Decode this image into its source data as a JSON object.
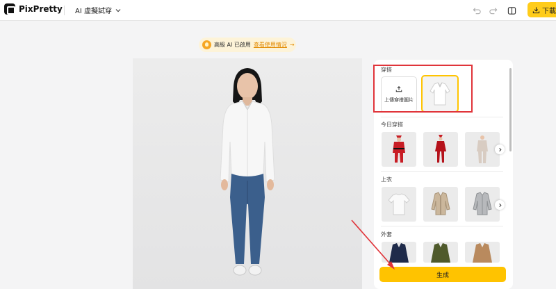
{
  "app": {
    "name": "PixPretty"
  },
  "header": {
    "tool_name": "AI 虛擬試穿",
    "download_label": "下載"
  },
  "credits_banner": {
    "status_text": "高級 AI 已啟用",
    "link_text": "查看使用情況",
    "arrow": "→"
  },
  "panel": {
    "outfit_label": "穿搭",
    "upload_label": "上傳穿搭圖片",
    "sections": [
      {
        "label": "今日穿搭",
        "items": [
          "santa-costume",
          "red-santa-dress",
          "beige-suit"
        ]
      },
      {
        "label": "上衣",
        "items": [
          "white-tshirt",
          "beige-cardigan",
          "grey-shirt"
        ]
      },
      {
        "label": "外套",
        "items": [
          "navy-jacket",
          "olive-jacket",
          "camel-coat"
        ]
      }
    ],
    "generate_label": "生成"
  },
  "colors": {
    "accent": "#ffc300",
    "highlight": "#e0343a",
    "banner_bg": "#fdf3d8",
    "link": "#e28a00"
  }
}
